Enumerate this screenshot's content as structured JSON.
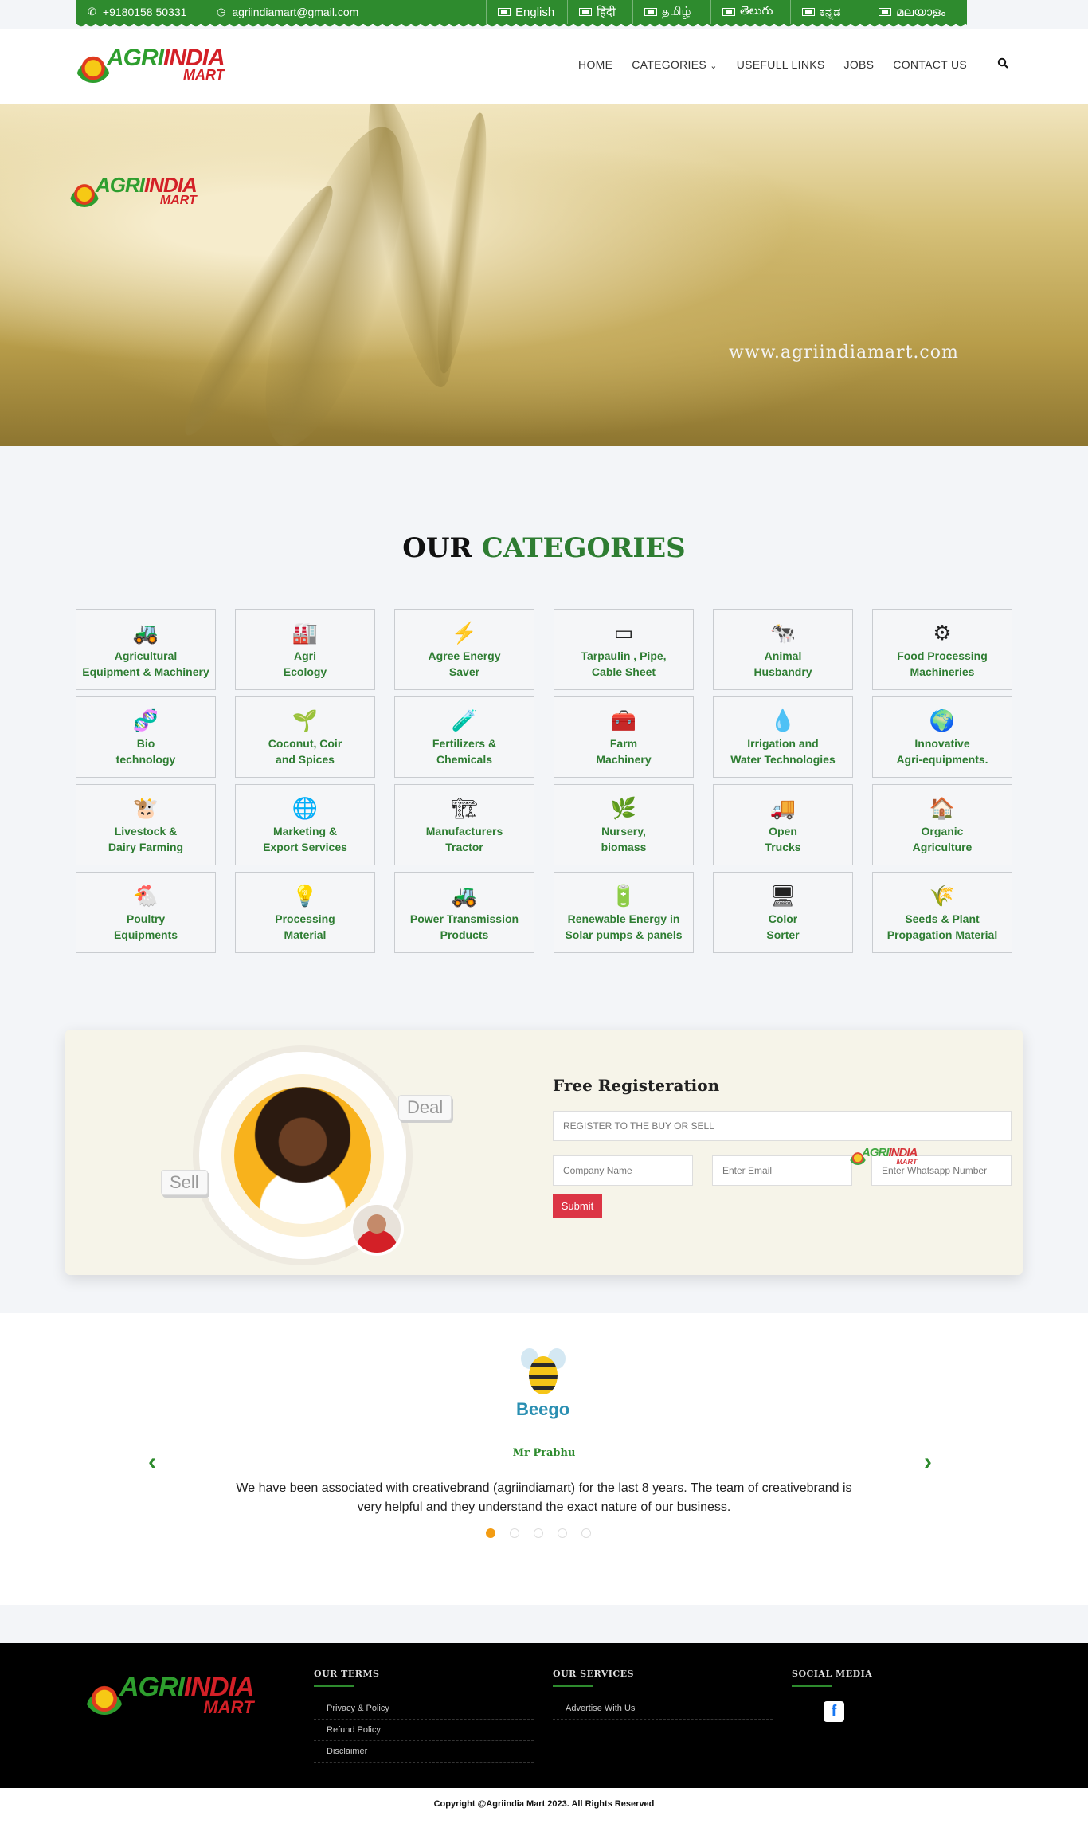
{
  "topbar": {
    "phone": "+9180158 50331",
    "email": "agriindiamart@gmail.com",
    "languages": [
      "English",
      "हिंदी",
      "தமிழ்",
      "తెలుగు",
      "ಕನ್ನಡ",
      "മലയാളം"
    ]
  },
  "logo": {
    "part1": "AGRI",
    "part2": "INDIA",
    "part3": "MART"
  },
  "nav": {
    "items": [
      "HOME",
      "CATEGORIES",
      "USEFULL LINKS",
      "JOBS",
      "CONTACT US"
    ],
    "categories_caret": "⌄"
  },
  "hero": {
    "url": "www.agriindiamart.com"
  },
  "categories": {
    "title_1": "OUR",
    "title_2": "CATEGORIES",
    "items": [
      {
        "label": "Agricultural\nEquipment & Machinery",
        "icon": "🚜"
      },
      {
        "label": "Agri\nEcology",
        "icon": "🏭"
      },
      {
        "label": "Agree Energy\nSaver",
        "icon": "⚡"
      },
      {
        "label": "Tarpaulin , Pipe,\nCable Sheet",
        "icon": "▭"
      },
      {
        "label": "Animal\nHusbandry",
        "icon": "🐄"
      },
      {
        "label": "Food Processing\nMachineries",
        "icon": "⚙"
      },
      {
        "label": "Bio\ntechnology",
        "icon": "🧬"
      },
      {
        "label": "Coconut, Coir\nand Spices",
        "icon": "🌱"
      },
      {
        "label": "Fertilizers &\nChemicals",
        "icon": "🧪"
      },
      {
        "label": "Farm\nMachinery",
        "icon": "🧰"
      },
      {
        "label": "Irrigation and\nWater Technologies",
        "icon": "💧"
      },
      {
        "label": "Innovative\nAgri-equipments.",
        "icon": "🌍"
      },
      {
        "label": "Livestock &\nDairy Farming",
        "icon": "🐮"
      },
      {
        "label": "Marketing &\nExport Services",
        "icon": "🌐"
      },
      {
        "label": "Manufacturers\nTractor",
        "icon": "🏗"
      },
      {
        "label": "Nursery,\nbiomass",
        "icon": "🌿"
      },
      {
        "label": "Open\nTrucks",
        "icon": "🚚"
      },
      {
        "label": "Organic\nAgriculture",
        "icon": "🏠"
      },
      {
        "label": "Poultry\nEquipments",
        "icon": "🐔"
      },
      {
        "label": "Processing\nMaterial",
        "icon": "💡"
      },
      {
        "label": "Power Transmission\nProducts",
        "icon": "🚜"
      },
      {
        "label": "Renewable Energy in\nSolar pumps & panels",
        "icon": "🔋"
      },
      {
        "label": "Color\nSorter",
        "icon": "🖥"
      },
      {
        "label": "Seeds & Plant\nPropagation Material",
        "icon": "🌾"
      }
    ]
  },
  "registration": {
    "title": "Free Registeration",
    "tag_deal": "Deal",
    "tag_sell": "Sell",
    "main_placeholder": "REGISTER TO THE BUY OR SELL",
    "company_placeholder": "Company Name",
    "email_placeholder": "Enter Email",
    "whatsapp_placeholder": "Enter Whatsapp Number",
    "submit": "Submit"
  },
  "testimonial": {
    "logo_text": "Beego",
    "name": "Mr Prabhu",
    "quote": "We have been associated with creativebrand (agriindiamart) for the last 8 years. The team of creativebrand is very helpful and they understand the exact nature of our business.",
    "prev": "‹",
    "next": "›",
    "active_slide": 1,
    "slide_count": 5
  },
  "footer": {
    "terms_title": "OUR TERMS",
    "terms": [
      "Privacy & Policy",
      "Refund Policy",
      "Disclaimer"
    ],
    "services_title": "OUR SERVICES",
    "services": [
      "Advertise With Us"
    ],
    "social_title": "SOCIAL MEDIA",
    "facebook": "f",
    "copyright": "Copyright @Agriindia Mart 2023. All Rights Reserved"
  },
  "colors": {
    "brand_green": "#2e8b2e",
    "brand_red": "#d32027",
    "submit_red": "#dc3545",
    "dot_active": "#f39c12"
  }
}
